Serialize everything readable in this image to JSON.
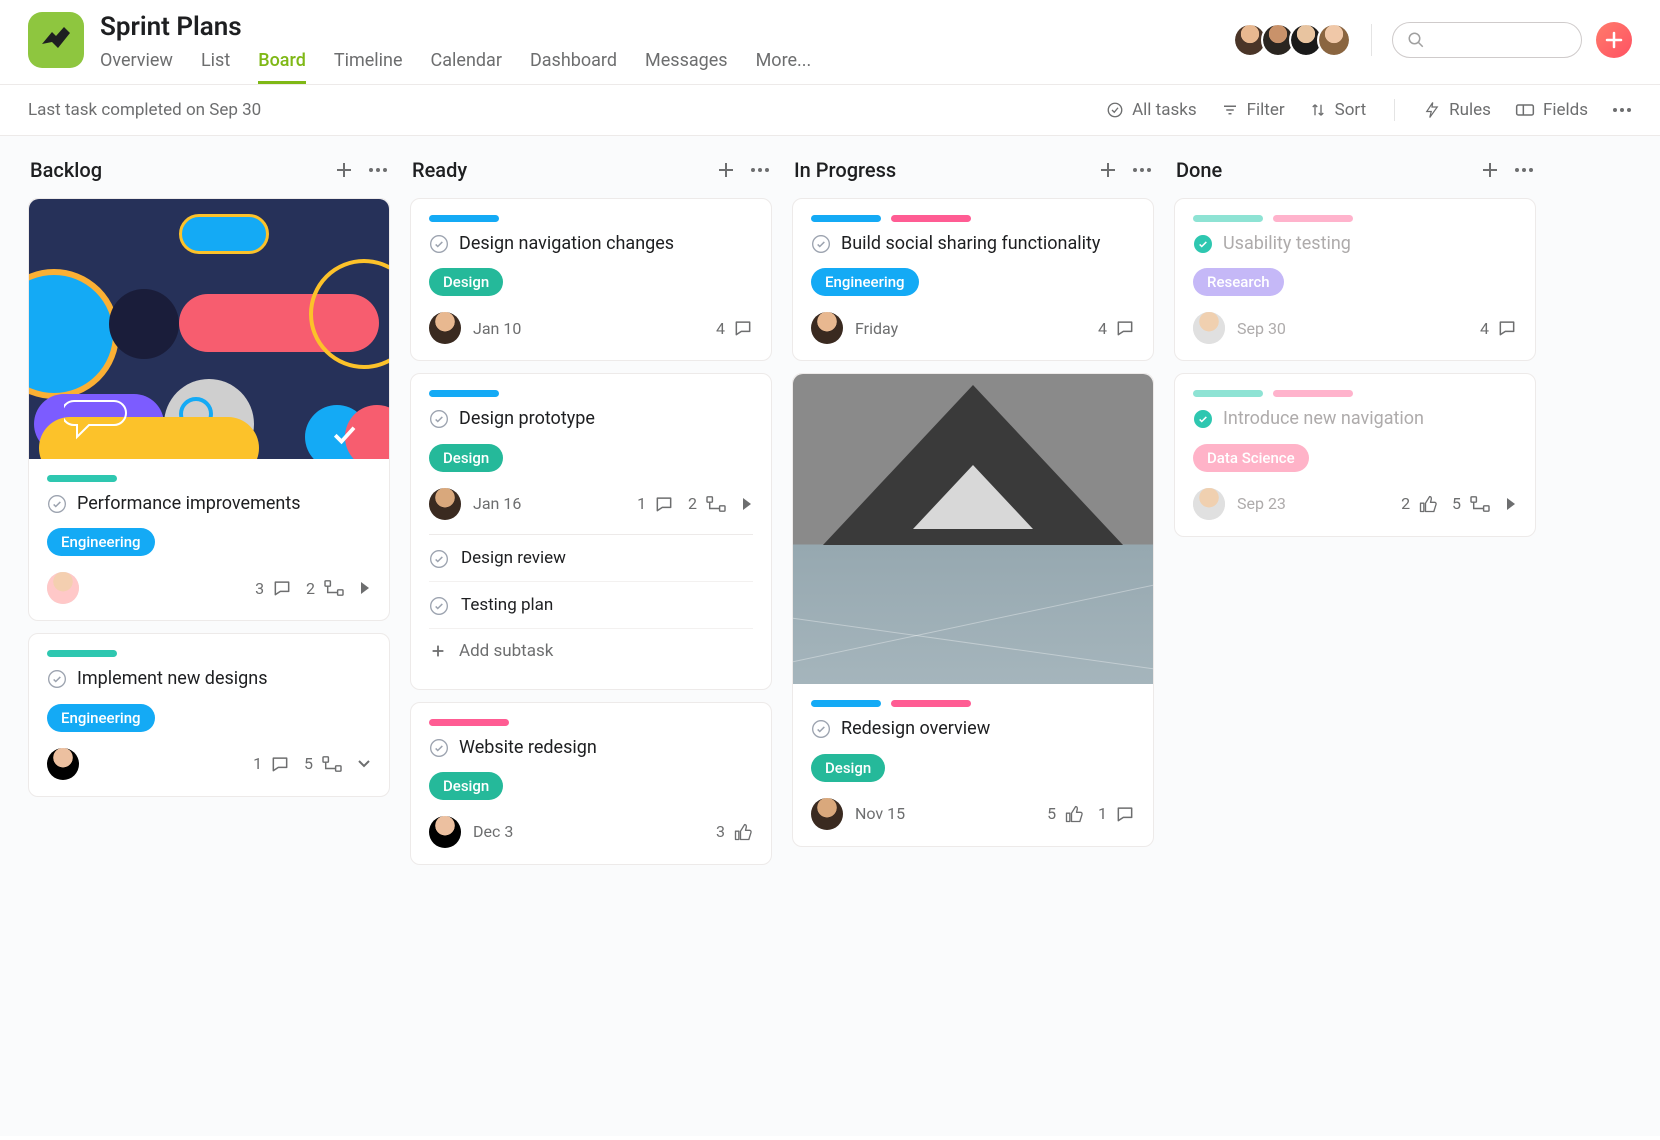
{
  "header": {
    "title": "Sprint Plans",
    "tabs": [
      "Overview",
      "List",
      "Board",
      "Timeline",
      "Calendar",
      "Dashboard",
      "Messages",
      "More..."
    ],
    "active_tab": "Board"
  },
  "toolbar": {
    "status": "Last task completed on Sep 30",
    "all_tasks": "All tasks",
    "filter": "Filter",
    "sort": "Sort",
    "rules": "Rules",
    "fields": "Fields"
  },
  "columns": [
    {
      "name": "Backlog",
      "cards": [
        {
          "has_cover": true,
          "cover_kind": "abstract",
          "stripes": [
            "teal"
          ],
          "title": "Performance improvements",
          "tag": "Engineering",
          "tag_class": "engineering",
          "assignee_class": "a5",
          "due": "",
          "meta": [
            {
              "icon": "comment",
              "count": 3
            },
            {
              "icon": "subtask",
              "count": 2
            },
            {
              "icon": "play",
              "count": ""
            }
          ]
        },
        {
          "stripes": [
            "teal"
          ],
          "title": "Implement new designs",
          "tag": "Engineering",
          "tag_class": "engineering",
          "assignee_class": "a7",
          "due": "",
          "meta": [
            {
              "icon": "comment",
              "count": 1
            },
            {
              "icon": "subtask",
              "count": 5
            },
            {
              "icon": "chevron",
              "count": ""
            }
          ]
        }
      ]
    },
    {
      "name": "Ready",
      "cards": [
        {
          "stripes": [
            "blue"
          ],
          "title": "Design navigation changes",
          "tag": "Design",
          "tag_class": "design",
          "assignee_class": "a6",
          "due": "Jan 10",
          "meta": [
            {
              "icon": "comment",
              "count": 4
            }
          ]
        },
        {
          "stripes": [
            "blue"
          ],
          "title": "Design prototype",
          "tag": "Design",
          "tag_class": "design",
          "assignee_class": "a8",
          "due": "Jan 16",
          "meta": [
            {
              "icon": "comment",
              "count": 1
            },
            {
              "icon": "subtask",
              "count": 2
            },
            {
              "icon": "play",
              "count": ""
            }
          ],
          "subtasks": [
            "Design review",
            "Testing plan"
          ],
          "add_subtask": "Add subtask"
        },
        {
          "stripes": [
            "pink"
          ],
          "title": "Website redesign",
          "tag": "Design",
          "tag_class": "design",
          "assignee_class": "a7",
          "due": "Dec 3",
          "meta": [
            {
              "icon": "like",
              "count": 3
            }
          ]
        }
      ]
    },
    {
      "name": "In Progress",
      "cards": [
        {
          "stripes": [
            "blue",
            "pink"
          ],
          "title": "Build social sharing functionality",
          "tag": "Engineering",
          "tag_class": "engineering",
          "assignee_class": "a6",
          "due": "Friday",
          "meta": [
            {
              "icon": "comment",
              "count": 4
            }
          ]
        },
        {
          "has_cover": true,
          "cover_kind": "mountain",
          "stripes": [
            "blue",
            "pink"
          ],
          "title": "Redesign overview",
          "tag": "Design",
          "tag_class": "design",
          "assignee_class": "a8",
          "due": "Nov 15",
          "meta": [
            {
              "icon": "like",
              "count": 5
            },
            {
              "icon": "comment",
              "count": 1
            }
          ]
        }
      ]
    },
    {
      "name": "Done",
      "cards": [
        {
          "done": true,
          "stripes": [
            "teallight",
            "pinklight"
          ],
          "title": "Usability testing",
          "tag": "Research",
          "tag_class": "research-light",
          "assignee_class": "a9",
          "due": "Sep 30",
          "meta": [
            {
              "icon": "comment",
              "count": 4
            }
          ]
        },
        {
          "done": true,
          "stripes": [
            "teallight",
            "pinklight"
          ],
          "title": "Introduce new navigation",
          "tag": "Data Science",
          "tag_class": "datascience",
          "assignee_class": "a9",
          "due": "Sep 23",
          "meta": [
            {
              "icon": "like",
              "count": 2
            },
            {
              "icon": "subtask",
              "count": 5
            },
            {
              "icon": "play",
              "count": ""
            }
          ]
        }
      ]
    }
  ]
}
